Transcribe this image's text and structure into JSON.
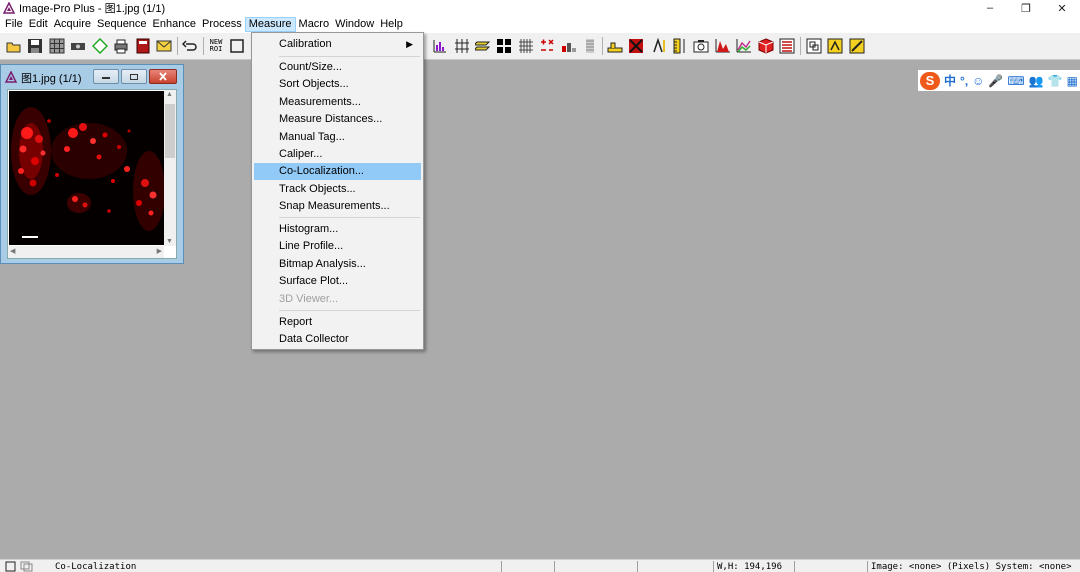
{
  "window": {
    "title": "Image-Pro Plus - 图1.jpg (1/1)",
    "minimize": "–",
    "restore": "❐",
    "close": "✕"
  },
  "menubar": {
    "items": [
      "File",
      "Edit",
      "Acquire",
      "Sequence",
      "Enhance",
      "Process",
      "Measure",
      "Macro",
      "Window",
      "Help"
    ],
    "active": "Measure"
  },
  "toolbar": {
    "new_roi": "NEW ROI"
  },
  "child_window": {
    "title": "图1.jpg (1/1)"
  },
  "measure_menu": {
    "items": [
      {
        "label": "Calibration",
        "submenu": true
      },
      {
        "label": "Count/Size..."
      },
      {
        "label": "Sort Objects..."
      },
      {
        "label": "Measurements..."
      },
      {
        "label": "Measure Distances..."
      },
      {
        "label": "Manual Tag..."
      },
      {
        "label": "Caliper..."
      },
      {
        "label": "Co-Localization...",
        "highlighted": true
      },
      {
        "label": "Track Objects..."
      },
      {
        "label": "Snap Measurements..."
      },
      {
        "label": "Histogram..."
      },
      {
        "label": "Line Profile..."
      },
      {
        "label": "Bitmap Analysis..."
      },
      {
        "label": "Surface Plot..."
      },
      {
        "label": "3D Viewer...",
        "disabled": true
      },
      {
        "label": "Report"
      },
      {
        "label": "Data Collector"
      }
    ],
    "highlight_color": "#91c9f7"
  },
  "ime": {
    "logo": "S",
    "items": [
      "中",
      "°,",
      "☺",
      "🎤",
      "⌨",
      "👥",
      "👕",
      "▦"
    ]
  },
  "statusbar": {
    "message": "Co-Localization",
    "wh": "W,H: 194,196",
    "image_info": "Image: <none> (Pixels) System: <none>"
  }
}
